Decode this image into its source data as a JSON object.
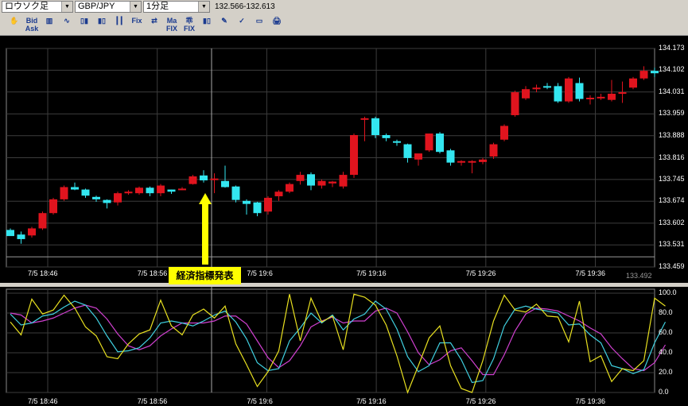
{
  "toolbar": {
    "chart_type": "ロウソク足",
    "pair": "GBP/JPY",
    "timeframe": "1分足",
    "price_range": "132.566-132.613",
    "buttons": [
      {
        "label": "✋",
        "name": "hand-tool-icon"
      },
      {
        "label": "Bid Ask",
        "name": "bid-ask-button"
      },
      {
        "label": "▥",
        "name": "bar-chart-icon"
      },
      {
        "label": "∿",
        "name": "line-chart-icon"
      },
      {
        "label": "▯▮",
        "name": "candle-icon"
      },
      {
        "label": "▮▯",
        "name": "candle2-icon"
      },
      {
        "label": "┃┃",
        "name": "ohlc-icon"
      },
      {
        "label": "Fix",
        "name": "fix-button"
      },
      {
        "label": "⇄",
        "name": "scroll-icon"
      },
      {
        "label": "Ma FIX",
        "name": "ma-fix-button"
      },
      {
        "label": "乖 FIX",
        "name": "kairi-fix-button"
      },
      {
        "label": "▮▯",
        "name": "candle3-icon"
      },
      {
        "label": "✎",
        "name": "draw-line-icon"
      },
      {
        "label": "✓",
        "name": "check-icon"
      },
      {
        "label": "▭",
        "name": "window-icon"
      },
      {
        "label": "🖨",
        "name": "print-icon"
      }
    ]
  },
  "y_labels": [
    "134.173",
    "134.102",
    "134.031",
    "133.959",
    "133.888",
    "133.816",
    "133.745",
    "133.674",
    "133.602",
    "133.531",
    "133.459"
  ],
  "x_labels": [
    "7/5 18:46",
    "7/5 18:56",
    "7/5 19:6",
    "7/5 19:16",
    "7/5 19:26",
    "7/5 19:36"
  ],
  "osc_labels": [
    "100.0",
    "80.0",
    "60.0",
    "40.0",
    "20.0",
    "0.0"
  ],
  "current_price": "133.492",
  "annotation": "経済指標発表",
  "colors": {
    "up": "#e0141e",
    "down": "#33e6f0",
    "bg": "#000000",
    "grid": "#3c3c3c",
    "yellow": "#ffff00",
    "osc_k": "#e8e020",
    "osc_d": "#40d0e0",
    "osc_sd": "#d040d0"
  },
  "chart_data": {
    "type": "candlestick",
    "ylim": [
      133.459,
      134.173
    ],
    "candles": [
      [
        133.58,
        133.585,
        133.57,
        133.56
      ],
      [
        133.565,
        133.575,
        133.535,
        133.55
      ],
      [
        133.562,
        133.59,
        133.555,
        133.585
      ],
      [
        133.585,
        133.64,
        133.58,
        133.635
      ],
      [
        133.635,
        133.685,
        133.63,
        133.68
      ],
      [
        133.68,
        133.725,
        133.675,
        133.72
      ],
      [
        133.72,
        133.735,
        133.71,
        133.712
      ],
      [
        133.712,
        133.715,
        133.685,
        133.692
      ],
      [
        133.688,
        133.692,
        133.672,
        133.68
      ],
      [
        133.678,
        133.68,
        133.65,
        133.668
      ],
      [
        133.67,
        133.705,
        133.66,
        133.7
      ],
      [
        133.7,
        133.71,
        133.695,
        133.705
      ],
      [
        133.7,
        133.722,
        133.695,
        133.718
      ],
      [
        133.718,
        133.722,
        133.69,
        133.7
      ],
      [
        133.7,
        133.73,
        133.69,
        133.725
      ],
      [
        133.712,
        133.712,
        133.698,
        133.705
      ],
      [
        133.715,
        133.72,
        133.71,
        133.715
      ],
      [
        133.73,
        133.76,
        133.728,
        133.755
      ],
      [
        133.758,
        133.775,
        133.735,
        133.742
      ],
      [
        133.748,
        133.765,
        133.7,
        133.748
      ],
      [
        133.74,
        133.79,
        133.718,
        133.72
      ],
      [
        133.722,
        133.725,
        133.67,
        133.678
      ],
      [
        133.675,
        133.68,
        133.63,
        133.665
      ],
      [
        133.67,
        133.672,
        133.625,
        133.635
      ],
      [
        133.64,
        133.69,
        133.63,
        133.685
      ],
      [
        133.69,
        133.71,
        133.675,
        133.705
      ],
      [
        133.705,
        133.735,
        133.7,
        133.73
      ],
      [
        133.74,
        133.77,
        133.728,
        133.76
      ],
      [
        133.762,
        133.768,
        133.71,
        133.725
      ],
      [
        133.725,
        133.745,
        133.715,
        133.74
      ],
      [
        133.732,
        133.74,
        133.72,
        133.738
      ],
      [
        133.722,
        133.77,
        133.715,
        133.76
      ],
      [
        133.76,
        133.895,
        133.75,
        133.89
      ],
      [
        133.94,
        133.95,
        133.87,
        133.945
      ],
      [
        133.945,
        133.95,
        133.88,
        133.89
      ],
      [
        133.89,
        133.895,
        133.87,
        133.88
      ],
      [
        133.87,
        133.875,
        133.855,
        133.868
      ],
      [
        133.86,
        133.862,
        133.8,
        133.815
      ],
      [
        133.81,
        133.825,
        133.79,
        133.83
      ],
      [
        133.84,
        133.895,
        133.835,
        133.895
      ],
      [
        133.895,
        133.9,
        133.83,
        133.835
      ],
      [
        133.84,
        133.845,
        133.79,
        133.8
      ],
      [
        133.8,
        133.808,
        133.79,
        133.805
      ],
      [
        133.805,
        133.808,
        133.765,
        133.805
      ],
      [
        133.802,
        133.815,
        133.795,
        133.81
      ],
      [
        133.82,
        133.865,
        133.812,
        133.86
      ],
      [
        133.875,
        133.925,
        133.87,
        133.92
      ],
      [
        133.955,
        134.035,
        133.95,
        134.03
      ],
      [
        134.01,
        134.05,
        134.005,
        134.04
      ],
      [
        134.04,
        134.055,
        134.03,
        134.045
      ],
      [
        134.05,
        134.06,
        134.04,
        134.045
      ],
      [
        134.05,
        134.06,
        133.995,
        134.0
      ],
      [
        134.0,
        134.08,
        133.995,
        134.075
      ],
      [
        134.06,
        134.078,
        134.0,
        134.008
      ],
      [
        134.008,
        134.02,
        133.99,
        134.012
      ],
      [
        134.012,
        134.025,
        134.005,
        134.015
      ],
      [
        134.005,
        134.07,
        134.0,
        134.025
      ],
      [
        134.025,
        134.065,
        133.995,
        134.03
      ],
      [
        134.045,
        134.08,
        134.04,
        134.075
      ],
      [
        134.075,
        134.115,
        134.07,
        134.1
      ],
      [
        134.1,
        134.11,
        134.08,
        134.092
      ]
    ],
    "stoch_k": [
      71,
      58,
      94,
      79,
      83,
      98,
      85,
      66,
      57,
      36,
      34,
      49,
      59,
      63,
      93,
      67,
      58,
      78,
      84,
      75,
      87,
      49,
      28,
      6,
      21,
      42,
      99,
      52,
      95,
      71,
      77,
      43,
      99,
      96,
      88,
      68,
      37,
      0,
      27,
      55,
      67,
      27,
      4,
      0,
      32,
      72,
      98,
      83,
      81,
      89,
      77,
      76,
      51,
      92,
      31,
      37,
      11,
      24,
      22,
      32,
      95,
      87
    ],
    "stoch_d": [
      79,
      68,
      70,
      77,
      79,
      86,
      92,
      88,
      75,
      57,
      41,
      42,
      45,
      55,
      70,
      72,
      70,
      67,
      72,
      78,
      82,
      71,
      54,
      30,
      22,
      24,
      52,
      65,
      80,
      70,
      78,
      63,
      74,
      79,
      92,
      84,
      64,
      36,
      21,
      27,
      50,
      50,
      33,
      10,
      12,
      34,
      67,
      84,
      87,
      84,
      82,
      80,
      68,
      69,
      58,
      50,
      27,
      24,
      19,
      23,
      50,
      71
    ],
    "stoch_sd": [
      80,
      78,
      70,
      72,
      75,
      80,
      85,
      88,
      85,
      74,
      59,
      47,
      43,
      47,
      57,
      64,
      70,
      70,
      70,
      72,
      77,
      77,
      69,
      52,
      35,
      25,
      32,
      47,
      66,
      72,
      76,
      70,
      72,
      72,
      82,
      85,
      80,
      61,
      40,
      28,
      33,
      42,
      45,
      32,
      18,
      18,
      38,
      62,
      79,
      85,
      84,
      82,
      77,
      72,
      65,
      59,
      45,
      34,
      24,
      22,
      30,
      48
    ]
  }
}
